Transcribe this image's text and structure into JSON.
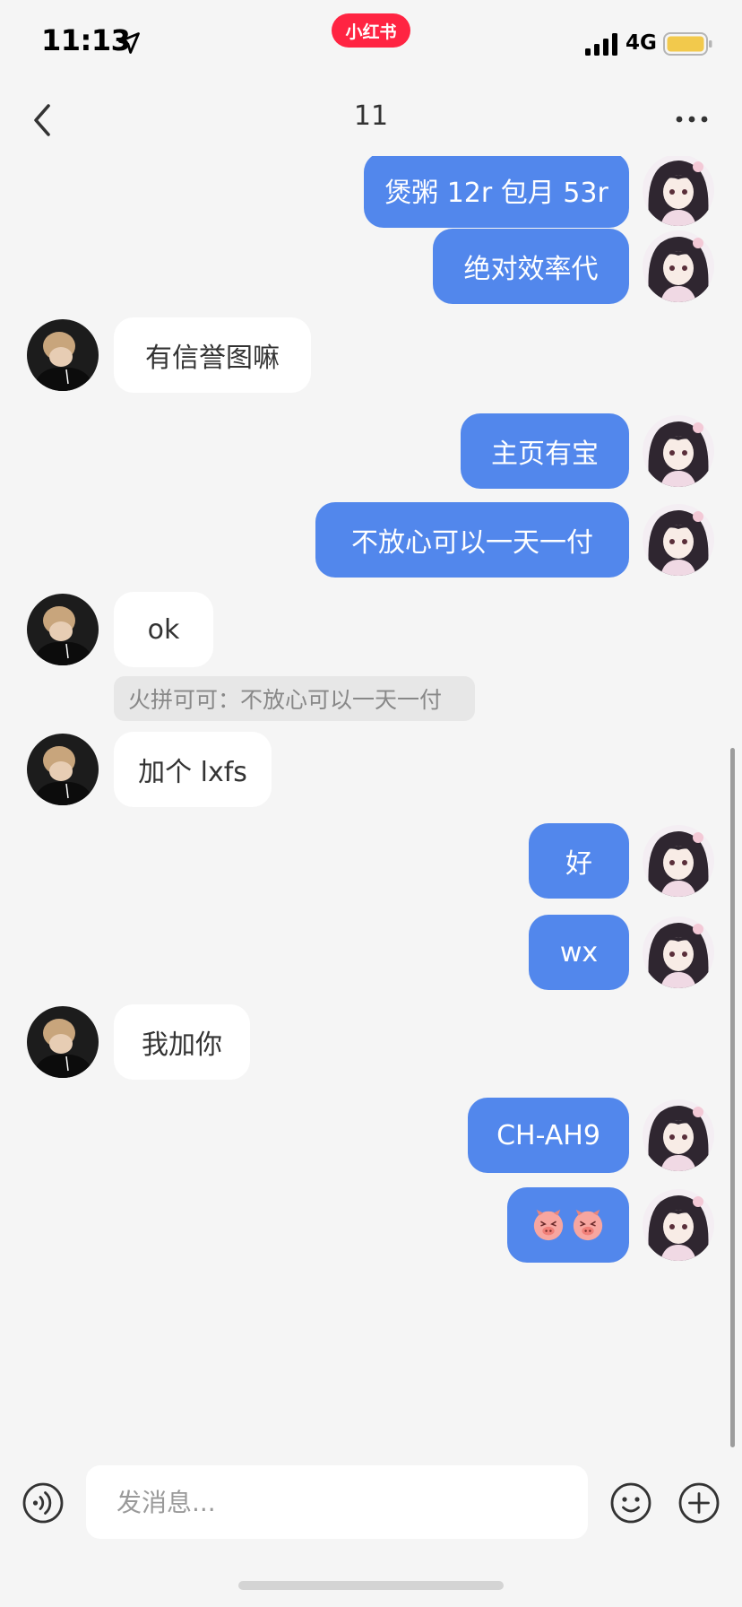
{
  "status_bar": {
    "time": "11:13",
    "app_badge": "小红书",
    "network": "4G",
    "icons": [
      "location-arrow-icon",
      "signal-icon",
      "battery-icon"
    ],
    "badge_color": "#ff2442",
    "battery_color": "#f2c94c"
  },
  "nav": {
    "title": "11",
    "back_icon": "chevron-left-icon",
    "more_icon": "more-dots-icon"
  },
  "colors": {
    "sent_bubble": "#5287ec",
    "received_bubble": "#ffffff",
    "background": "#f5f5f5"
  },
  "messages": [
    {
      "side": "sent",
      "text": "煲粥 12r 包月 53r"
    },
    {
      "side": "sent",
      "text": "绝对效率代"
    },
    {
      "side": "received",
      "text": "有信誉图嘛"
    },
    {
      "side": "sent",
      "text": "主页有宝"
    },
    {
      "side": "sent",
      "text": "不放心可以一天一付"
    },
    {
      "side": "received",
      "text": "ok",
      "quote": "火拼可可：不放心可以一天一付"
    },
    {
      "side": "received",
      "text": "加个 lxfs"
    },
    {
      "side": "sent",
      "text": "好"
    },
    {
      "side": "sent",
      "text": "wx"
    },
    {
      "side": "received",
      "text": "我加你"
    },
    {
      "side": "sent",
      "text": "CH-AH9"
    },
    {
      "side": "sent",
      "text": "",
      "emoji": [
        "pig-emoji-icon",
        "pig-emoji-icon"
      ]
    }
  ],
  "input": {
    "placeholder": "发消息...",
    "value": "",
    "voice_icon": "voice-icon",
    "emoji_icon": "smiley-icon",
    "add_icon": "plus-circle-icon"
  }
}
